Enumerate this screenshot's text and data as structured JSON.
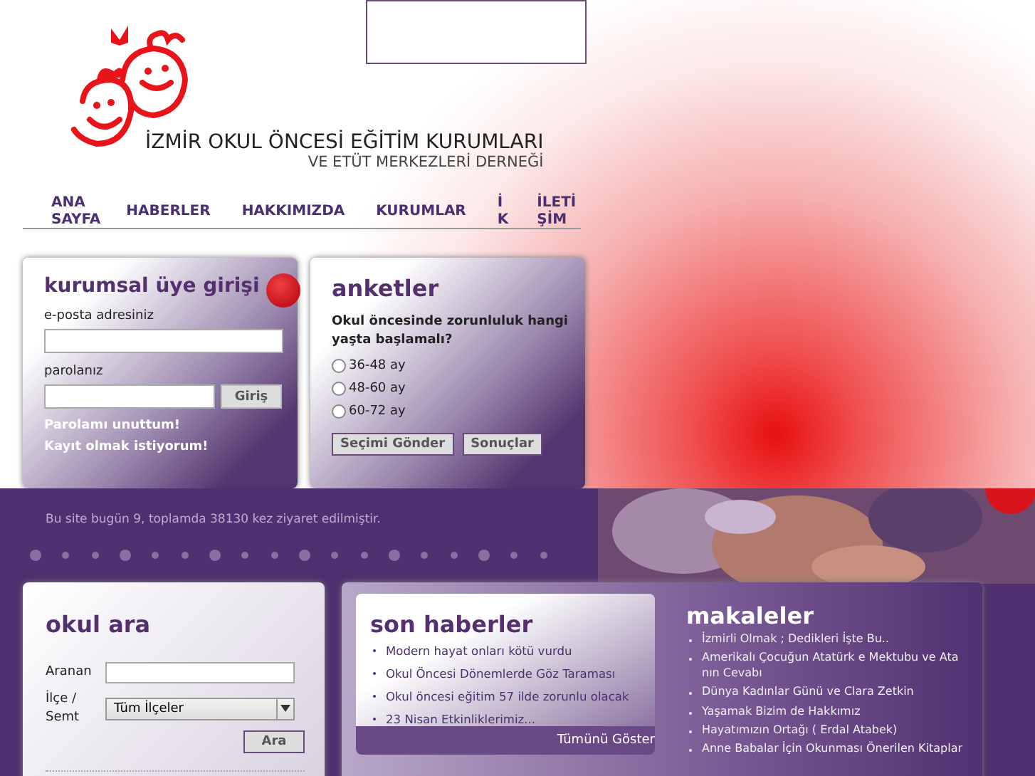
{
  "header": {
    "title": "İZMİR OKUL ÖNCESİ EĞİTİM KURUMLARI",
    "subtitle": "VE ETÜT MERKEZLERİ DERNEĞİ"
  },
  "nav": [
    "ANA SAYFA",
    "HABERLER",
    "HAKKIMIZDA",
    "KURUMLAR",
    "İK",
    "İLETİŞİM"
  ],
  "login": {
    "title": "kurumsal üye girişi",
    "email_label": "e-posta adresiniz",
    "password_label": "parolanız",
    "submit": "Giriş",
    "links": [
      "Parolamı unuttum!",
      "Kayıt olmak istiyorum!"
    ]
  },
  "poll": {
    "title": "anketler",
    "question": "Okul öncesinde zorunluluk hangi yaşta başlamalı?",
    "options": [
      {
        "label": "36-48 ay",
        "selected": false
      },
      {
        "label": "48-60 ay",
        "selected": false
      },
      {
        "label": "60-72 ay",
        "selected": false
      }
    ],
    "buttons": [
      "Seçimi Gönder",
      "Sonuçlar"
    ]
  },
  "visits": "Bu site bugün 9, toplamda 38130 kez ziyaret edilmiştir.",
  "search": {
    "title": "okul ara",
    "query_label": "Aranan",
    "district_label": "İlçe / Semt",
    "district_value": "Tüm İlçeler",
    "submit": "Ara"
  },
  "news": {
    "title": "son haberler",
    "items": [
      "Modern hayat onları kötü vurdu",
      "Okul Öncesi Dönemlerde Göz Taraması",
      "Okul öncesi eğitim 57 ilde zorunlu olacak",
      "23 Nisan Etkinliklerimiz..."
    ],
    "more": "Tümünü Göster"
  },
  "articles": {
    "title": "makaleler",
    "items": [
      "İzmirli Olmak ; Dedikleri İşte Bu..",
      "Amerikalı Çocuğun Atatürk e Mektubu ve Ata nın Cevabı",
      "Dünya Kadınlar Günü ve Clara Zetkin",
      "Yaşamak Bizim de Hakkımız",
      "Hayatımızın Ortağı ( Erdal Atabek)",
      "Anne Babalar İçin Okunması Önerilen Kitaplar"
    ]
  }
}
